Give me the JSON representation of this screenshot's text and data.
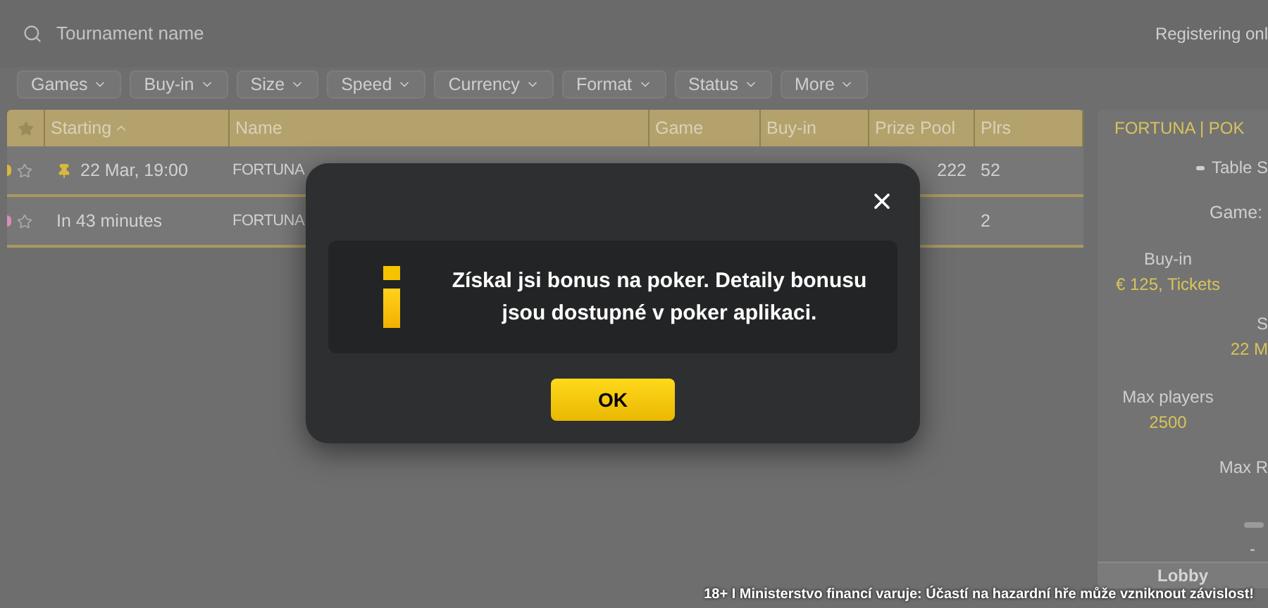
{
  "search": {
    "placeholder": "Tournament name"
  },
  "registering_filter": {
    "label": "Registering onl"
  },
  "filters": [
    "Games",
    "Buy-in",
    "Size",
    "Speed",
    "Currency",
    "Format",
    "Status",
    "More"
  ],
  "table": {
    "columns": [
      {
        "label": "Starting",
        "sorted": true
      },
      {
        "label": "Name",
        "sorted": false
      },
      {
        "label": "Game",
        "sorted": false
      },
      {
        "label": "Buy-in",
        "sorted": false
      },
      {
        "label": "Prize Pool",
        "sorted": false
      },
      {
        "label": "Plrs",
        "sorted": false
      }
    ],
    "rows": [
      {
        "color": "#d9b93c",
        "favorite": false,
        "pinned": true,
        "starting": "22 Mar, 19:00",
        "name": "FORTUNA",
        "prize_pool": "222",
        "players": "52"
      },
      {
        "color": "#d98fb5",
        "favorite": false,
        "pinned": false,
        "starting": "In 43 minutes",
        "name": "FORTUNA",
        "prize_pool": "",
        "players": "2"
      }
    ]
  },
  "details": {
    "title": "FORTUNA | POK",
    "table_label": "Table S",
    "game_label": "Game:",
    "buy_in_label": "Buy-in",
    "buy_in_value": "€ 125, Tickets",
    "start_label": "S",
    "start_value": "22 M",
    "max_players_label": "Max players",
    "max_players_value": "2500",
    "max_rebuys_label": "Max R",
    "dash": "-",
    "lobby_button": "Lobby"
  },
  "dialog": {
    "message": "Získal jsi bonus na poker. Detaily bonusu jsou dostupné v poker aplikaci.",
    "button": "OK"
  },
  "warning": "18+ I Ministerstvo financí varuje: Účastí na hazardní hře může vzniknout závislost!"
}
